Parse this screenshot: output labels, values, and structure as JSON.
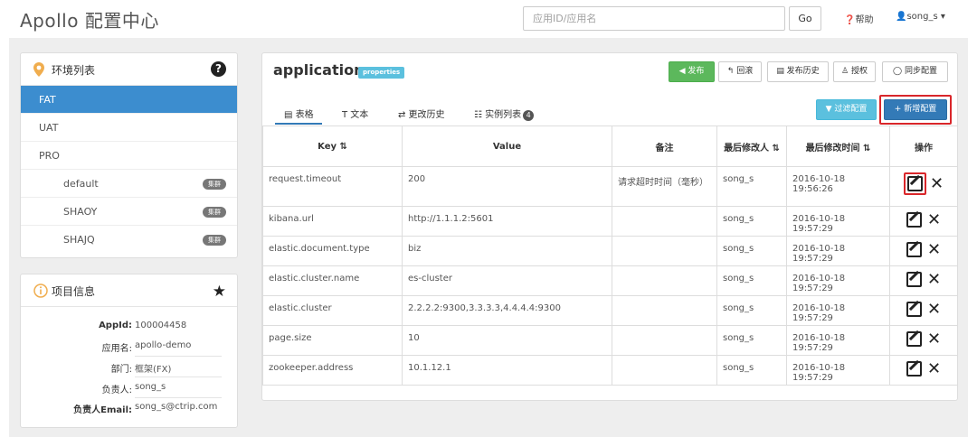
{
  "header": {
    "brand": "Apollo 配置中心",
    "search_placeholder": "应用ID/应用名",
    "go_label": "Go",
    "help_label": "❓帮助",
    "user_label": "👤song_s ▾"
  },
  "env_panel": {
    "title": "环境列表",
    "items": [
      {
        "label": "FAT",
        "active": true
      },
      {
        "label": "UAT"
      },
      {
        "label": "PRO"
      }
    ],
    "clusters": [
      {
        "label": "default",
        "badge": "集群"
      },
      {
        "label": "SHAOY",
        "badge": "集群"
      },
      {
        "label": "SHAJQ",
        "badge": "集群"
      }
    ]
  },
  "info_panel": {
    "title": "项目信息",
    "rows": [
      {
        "key": "AppId:",
        "value": "100004458"
      },
      {
        "key": "应用名:",
        "value": "apollo-demo"
      },
      {
        "key": "部门:",
        "value": "框架(FX)"
      },
      {
        "key": "负责人:",
        "value": "song_s"
      },
      {
        "key": "负责人Email:",
        "value": "song_s@ctrip.com"
      }
    ]
  },
  "namespace": {
    "name": "application",
    "format": "properties",
    "buttons": {
      "publish": "◀ 发布",
      "rollback": "↰ 回滚",
      "history": "▤ 发布历史",
      "auth": "♙ 授权",
      "sync": "◯ 同步配置",
      "filter": "▼ 过滤配置",
      "add": "+ 新增配置"
    },
    "tabs": [
      {
        "label": "▤ 表格"
      },
      {
        "label": "T 文本"
      },
      {
        "label": "⇄ 更改历史"
      },
      {
        "label": "☷ 实例列表",
        "count": "4"
      }
    ]
  },
  "table": {
    "headers": [
      "Key ⇅",
      "Value",
      "备注",
      "最后修改人 ⇅",
      "最后修改时间 ⇅",
      "操作"
    ],
    "rows": [
      {
        "key": "request.timeout",
        "value": "200",
        "comment": "请求超时时间（毫秒）",
        "modifier": "song_s",
        "time": "2016-10-18 19:56:26"
      },
      {
        "key": "kibana.url",
        "value": "http://1.1.1.2:5601",
        "comment": "",
        "modifier": "song_s",
        "time": "2016-10-18 19:57:29"
      },
      {
        "key": "elastic.document.type",
        "value": "biz",
        "comment": "",
        "modifier": "song_s",
        "time": "2016-10-18 19:57:29"
      },
      {
        "key": "elastic.cluster.name",
        "value": "es-cluster",
        "comment": "",
        "modifier": "song_s",
        "time": "2016-10-18 19:57:29"
      },
      {
        "key": "elastic.cluster",
        "value": "2.2.2.2:9300,3.3.3.3,4.4.4.4:9300",
        "comment": "",
        "modifier": "song_s",
        "time": "2016-10-18 19:57:29"
      },
      {
        "key": "page.size",
        "value": "10",
        "comment": "",
        "modifier": "song_s",
        "time": "2016-10-18 19:57:29"
      },
      {
        "key": "zookeeper.address",
        "value": "10.1.12.1",
        "comment": "",
        "modifier": "song_s",
        "time": "2016-10-18 19:57:29"
      }
    ]
  }
}
